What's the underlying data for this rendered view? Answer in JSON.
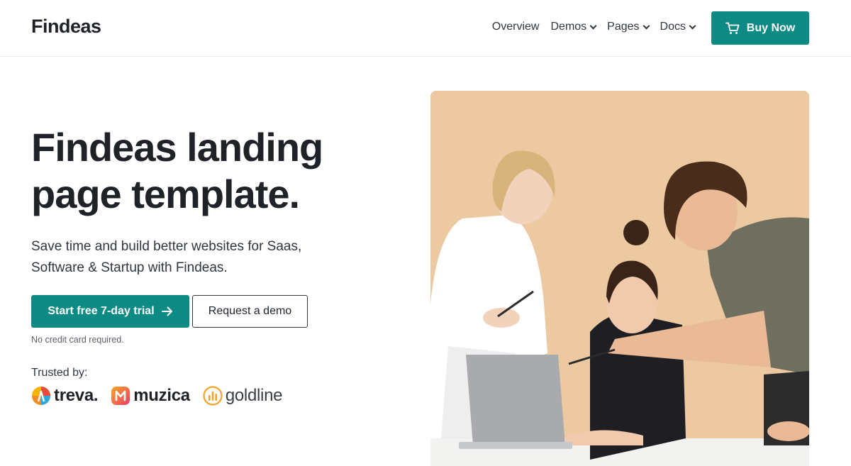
{
  "header": {
    "logo": "Findeas",
    "nav": [
      {
        "label": "Overview",
        "dropdown": false
      },
      {
        "label": "Demos",
        "dropdown": true
      },
      {
        "label": "Pages",
        "dropdown": true
      },
      {
        "label": "Docs",
        "dropdown": true
      }
    ],
    "buy_label": "Buy Now",
    "buy_icon": "cart-icon"
  },
  "hero": {
    "title_line1": "Findeas landing",
    "title_line2": "page template.",
    "subtitle_line1": "Save time and build better websites for Saas,",
    "subtitle_line2": "Software & Startup with Findeas.",
    "primary_cta": "Start free 7-day trial",
    "secondary_cta": "Request a demo",
    "note": "No credit card required.",
    "trusted_label": "Trusted by:",
    "brands": [
      "treva.",
      "muzica",
      "goldline"
    ]
  },
  "colors": {
    "accent": "#0e8a85",
    "photo_background": "#ecc9a0"
  }
}
